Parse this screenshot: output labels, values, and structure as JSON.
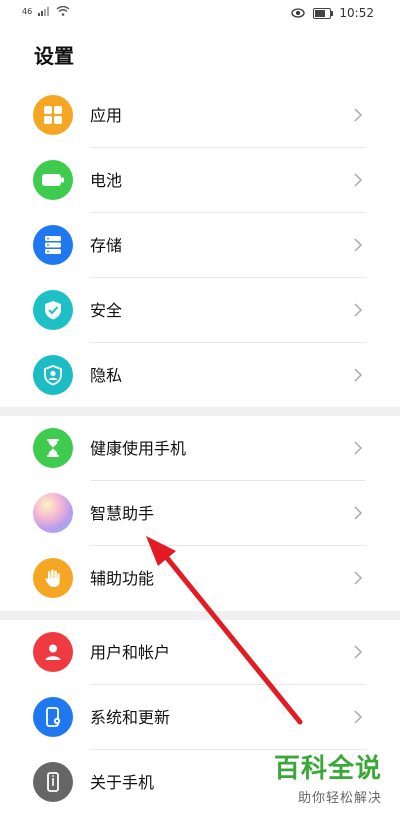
{
  "status_bar": {
    "left_indicator": "46",
    "time": "10:52"
  },
  "page_title": "设置",
  "groups": [
    {
      "items": [
        {
          "label": "应用",
          "icon": "apps-icon",
          "color": "#f5a623"
        },
        {
          "label": "电池",
          "icon": "battery-icon",
          "color": "#3ecb4e"
        },
        {
          "label": "存储",
          "icon": "storage-icon",
          "color": "#1f78f0"
        },
        {
          "label": "安全",
          "icon": "shield-check-icon",
          "color": "#1cc0c5"
        },
        {
          "label": "隐私",
          "icon": "privacy-icon",
          "color": "#1cbcc4"
        }
      ]
    },
    {
      "items": [
        {
          "label": "健康使用手机",
          "icon": "hourglass-icon",
          "color": "#3ecb4e"
        },
        {
          "label": "智慧助手",
          "icon": "smart-assistant-icon",
          "color": "#e9a6d8"
        },
        {
          "label": "辅助功能",
          "icon": "hand-icon",
          "color": "#f5a623"
        }
      ]
    },
    {
      "items": [
        {
          "label": "用户和帐户",
          "icon": "user-icon",
          "color": "#f03a42"
        },
        {
          "label": "系统和更新",
          "icon": "system-update-icon",
          "color": "#1f78f0"
        },
        {
          "label": "关于手机",
          "icon": "phone-info-icon",
          "color": "#666666"
        }
      ]
    }
  ],
  "watermark": {
    "main": "百科全说",
    "sub": "助你轻松解决"
  },
  "annotation_arrow_color": "#e31b23"
}
